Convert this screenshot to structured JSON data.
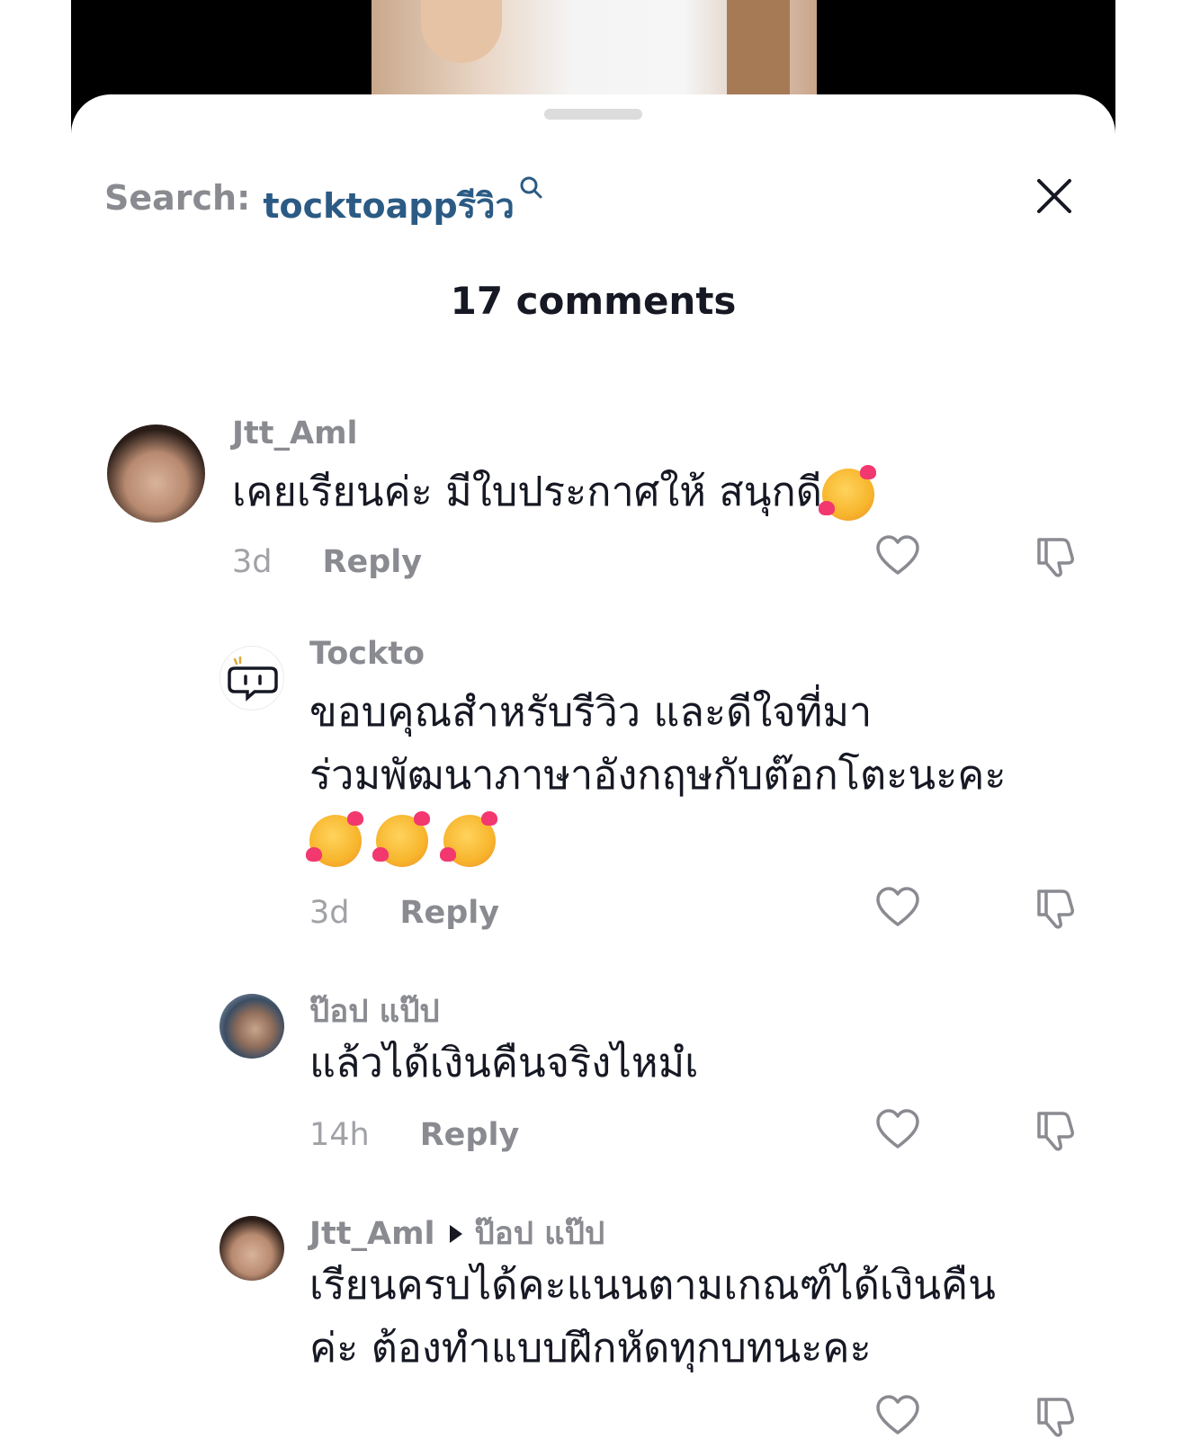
{
  "search": {
    "label": "Search:",
    "term": "tocktoappรีวิว"
  },
  "comments_title": "17 comments",
  "comments": [
    {
      "username": "Jtt_Aml",
      "text": "เคยเรียนค่ะ มีใบประกาศให้ สนุกดี",
      "emoji_count": 1,
      "time": "3d",
      "reply_label": "Reply"
    },
    {
      "username": "Tockto",
      "text_line1": "ขอบคุณสำหรับรีวิว และดีใจที่มา",
      "text_line2": "ร่วมพัฒนาภาษาอังกฤษกับต๊อกโตะนะคะ",
      "emoji_count": 3,
      "time": "3d",
      "reply_label": "Reply"
    },
    {
      "username": "ป๊อป แป๊ป",
      "text": "แล้วได้เงินคืนจริงไหมํเ",
      "time": "14h",
      "reply_label": "Reply"
    },
    {
      "username": "Jtt_Aml",
      "reply_to": "ป๊อป แป๊ป",
      "text_line1": "เรียนครบได้คะแนนตามเกณฑ์ได้เงินคืน",
      "text_line2": "ค่ะ ต้องทำแบบฝึกหัดทุกบทนะคะ"
    }
  ],
  "colors": {
    "search_term": "#2b5b84",
    "muted": "#8a8b91",
    "text": "#161823"
  },
  "icons": [
    "search-icon",
    "close-icon",
    "heart-icon",
    "dislike-icon"
  ]
}
